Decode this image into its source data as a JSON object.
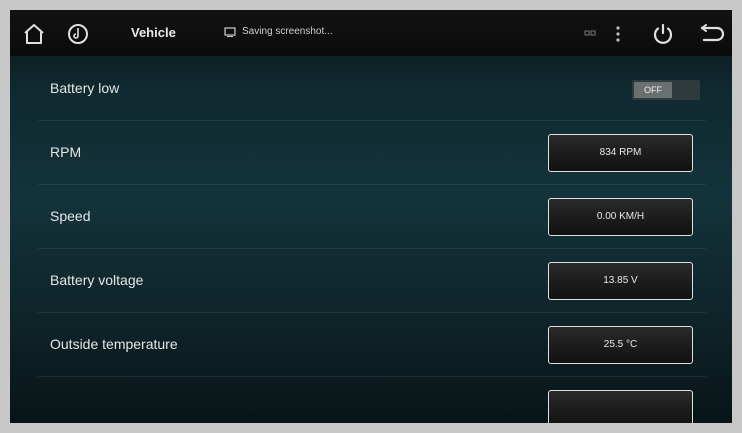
{
  "statusbar": {
    "home_icon": "home-icon",
    "music_icon": "music-disc-icon",
    "app_title": "Vehicle",
    "notification_icon": "screenshot-icon",
    "notification_text": "Saving screenshot...",
    "signal_icon": "signal-icon",
    "menu_icon": "more-vertical-icon",
    "power_icon": "power-icon",
    "back_icon": "back-arrow-icon"
  },
  "rows": [
    {
      "label": "Battery low",
      "toggle": "OFF"
    },
    {
      "label": "RPM",
      "value": "834 RPM"
    },
    {
      "label": "Speed",
      "value": "0.00 KM/H"
    },
    {
      "label": "Battery voltage",
      "value": "13.85 V"
    },
    {
      "label": "Outside temperature",
      "value": "25.5 °C"
    },
    {
      "label": "",
      "value": ""
    }
  ],
  "colors": {
    "accent": "#0f2a30",
    "statusbar": "#0b0b0b"
  }
}
